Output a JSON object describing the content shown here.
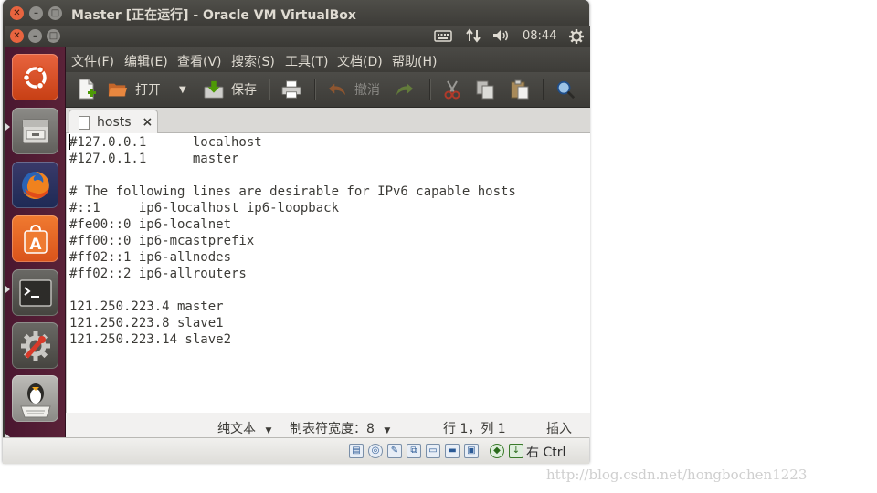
{
  "vbox": {
    "title": "Master [正在运行] - Oracle VM VirtualBox",
    "window_buttons": [
      "✕",
      "–",
      "□"
    ],
    "host_key": "右 Ctrl"
  },
  "guest": {
    "panel": {
      "window_buttons": [
        "✕",
        "–",
        "□"
      ],
      "clock": "08:44",
      "tray_icons": [
        "keyboard-icon",
        "network-icon",
        "volume-icon",
        "gear-icon"
      ]
    },
    "launcher": {
      "items": [
        "ubuntu-logo-icon",
        "files-icon",
        "firefox-icon",
        "software-center-icon",
        "terminal-icon",
        "settings-icon",
        "gedit-icon"
      ]
    },
    "gedit": {
      "menu": [
        "文件(F)",
        "编辑(E)",
        "查看(V)",
        "搜索(S)",
        "工具(T)",
        "文档(D)",
        "帮助(H)"
      ],
      "toolbar": {
        "open_label": "打开",
        "save_label": "保存",
        "undo_label": "撤消"
      },
      "tab": {
        "label": "hosts",
        "close": "×"
      },
      "lines": [
        "#127.0.0.1      localhost",
        "#127.0.1.1      master",
        "",
        "# The following lines are desirable for IPv6 capable hosts",
        "#::1     ip6-localhost ip6-loopback",
        "#fe00::0 ip6-localnet",
        "#ff00::0 ip6-mcastprefix",
        "#ff02::1 ip6-allnodes",
        "#ff02::2 ip6-allrouters",
        "",
        "121.250.223.4 master",
        "121.250.223.8 slave1",
        "121.250.223.14 slave2"
      ],
      "status": {
        "language": "纯文本",
        "tab_width": "制表符宽度：8",
        "position": "行 1，列 1",
        "mode": "插入"
      }
    }
  },
  "watermark": "http://blog.csdn.net/hongbochen1223",
  "colors": {
    "launcher": "#5a2238",
    "ubuntu_orange": "#dd4814",
    "close_button": "#e8643f"
  }
}
